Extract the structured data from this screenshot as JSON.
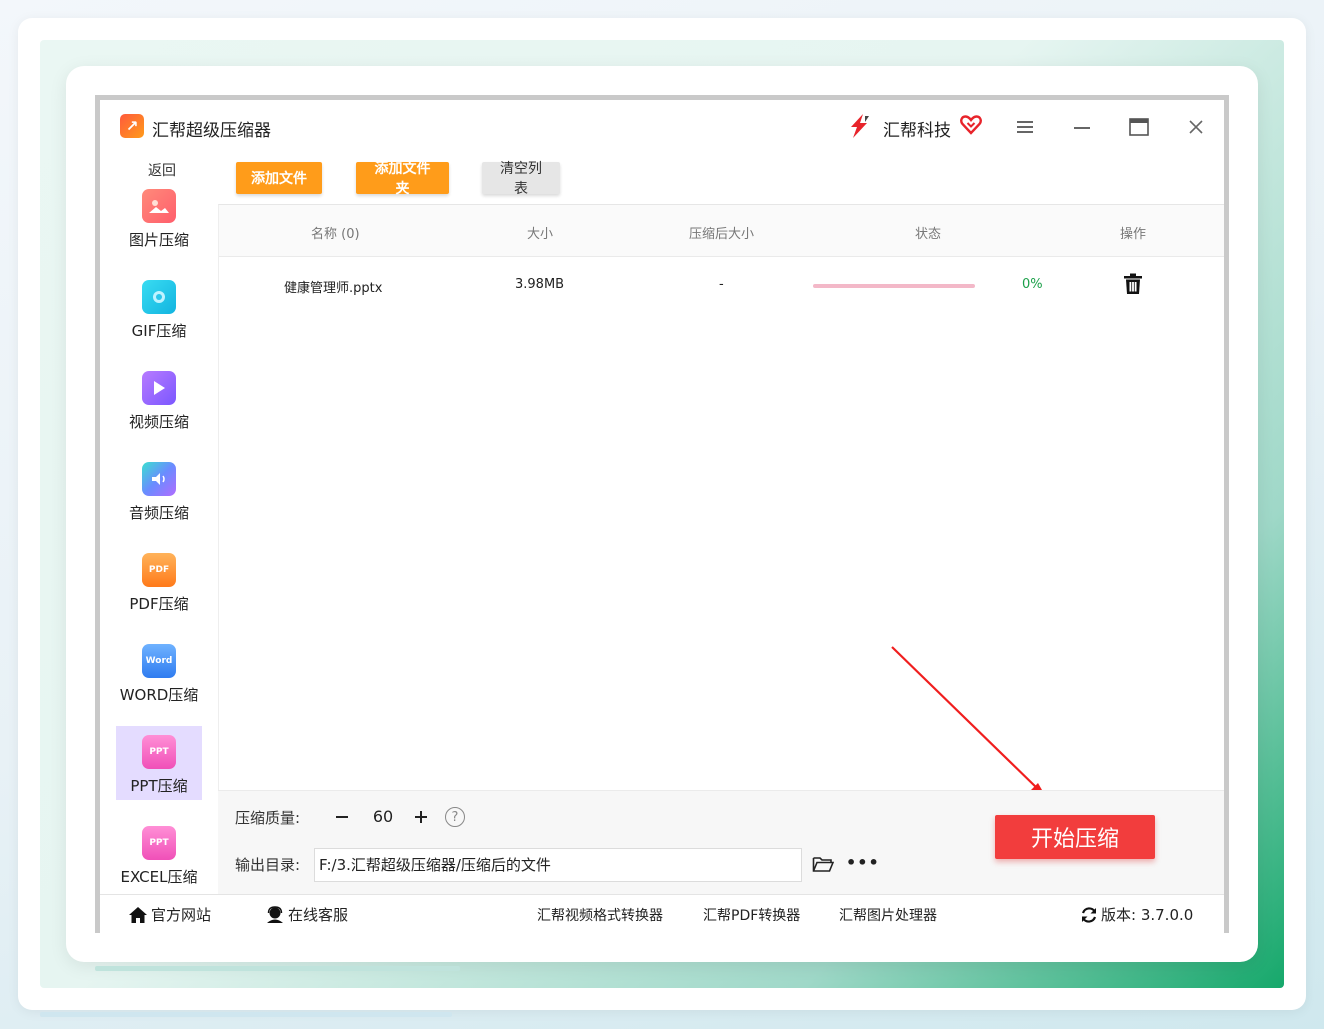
{
  "window": {
    "title": "汇帮超级压缩器",
    "brand": "汇帮科技"
  },
  "sidebar": {
    "back": "返回",
    "items": [
      {
        "label": "图片压缩",
        "icon": "image-icon",
        "color": "#ff6b5a"
      },
      {
        "label": "GIF压缩",
        "icon": "gif-icon",
        "color": "#19c2e6"
      },
      {
        "label": "视频压缩",
        "icon": "video-icon",
        "color": "#8b5cf6"
      },
      {
        "label": "音频压缩",
        "icon": "audio-icon",
        "color": "#4aa8ff"
      },
      {
        "label": "PDF压缩",
        "icon": "pdf-icon",
        "color": "#ff8a1f"
      },
      {
        "label": "WORD压缩",
        "icon": "word-icon",
        "color": "#2f8cff"
      },
      {
        "label": "PPT压缩",
        "icon": "ppt-icon",
        "color": "#f05ac0",
        "active": true
      },
      {
        "label": "EXCEL压缩",
        "icon": "excel-icon",
        "color": "#f05ac0"
      }
    ],
    "pdf_tag": "PDF",
    "word_tag": "Word",
    "ppt_tag": "PPT"
  },
  "toolbar": {
    "add_file": "添加文件",
    "add_folder": "添加文件夹",
    "clear_list": "清空列表"
  },
  "table": {
    "headers": {
      "name": "名称 (0)",
      "size": "大小",
      "compressed_size": "压缩后大小",
      "status": "状态",
      "action": "操作"
    },
    "rows": [
      {
        "name": "健康管理师.pptx",
        "size": "3.98MB",
        "compressed_size": "-",
        "progress": 0,
        "percent": "0%"
      }
    ]
  },
  "settings": {
    "quality_label": "压缩质量:",
    "quality_value": "60",
    "help": "?",
    "output_label": "输出目录:",
    "output_path": "F:/3.汇帮超级压缩器/压缩后的文件",
    "more": "•••",
    "start_button": "开始压缩"
  },
  "footer": {
    "website": "官方网站",
    "support": "在线客服",
    "links": [
      "汇帮视频格式转换器",
      "汇帮PDF转换器",
      "汇帮图片处理器"
    ],
    "version": "版本: 3.7.0.0"
  },
  "colors": {
    "orange": "#ff9c1a",
    "start_red": "#f23d3d",
    "progress_pink": "#f3b8c8",
    "percent_green": "#1ca04a",
    "active_nav": "#e4dcff"
  }
}
